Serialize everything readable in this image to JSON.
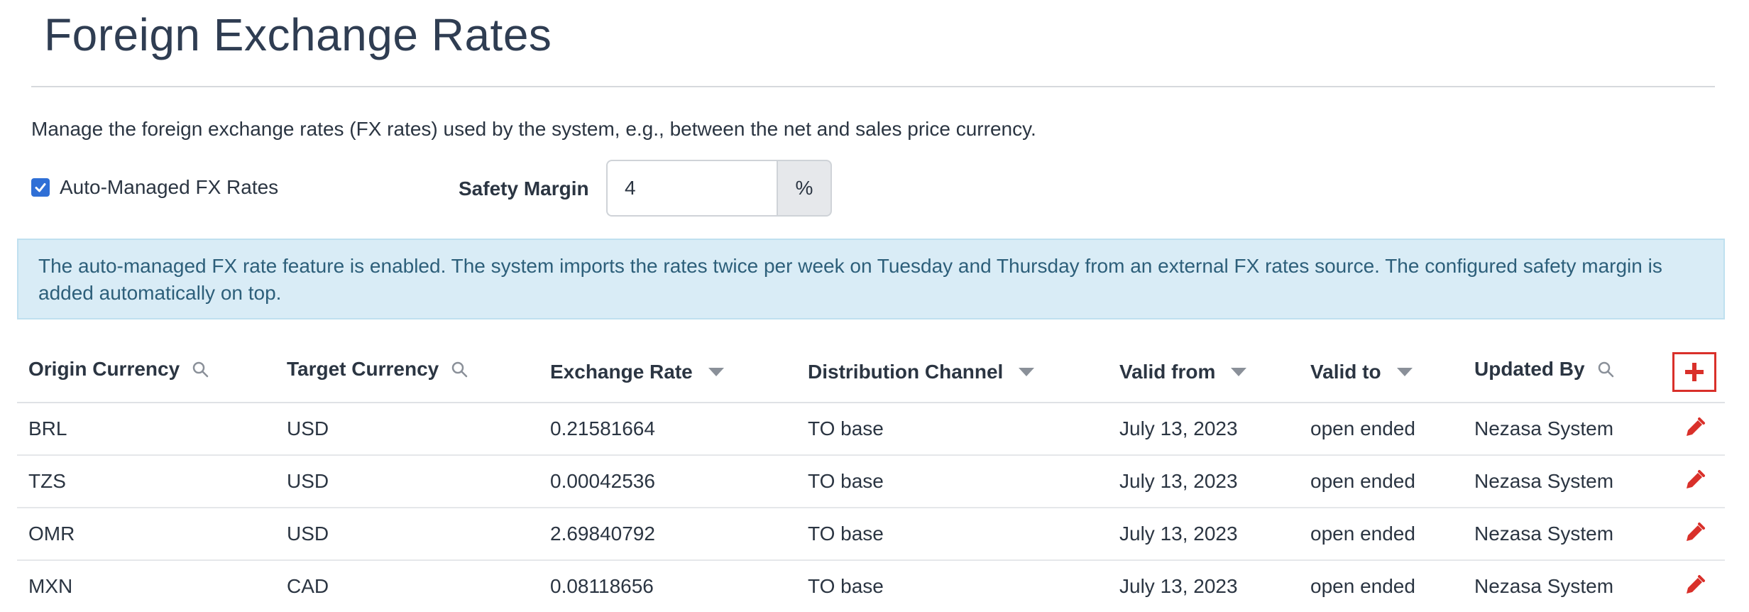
{
  "page": {
    "title": "Foreign Exchange Rates",
    "description": "Manage the foreign exchange rates (FX rates) used by the system, e.g., between the net and sales price currency."
  },
  "settings": {
    "auto_managed_label": "Auto-Managed FX Rates",
    "auto_managed_checked": true,
    "safety_margin_label": "Safety Margin",
    "safety_margin_value": "4",
    "safety_margin_unit": "%"
  },
  "info": {
    "message": "The auto-managed FX rate feature is enabled. The system imports the rates twice per week on Tuesday and Thursday from an external FX rates source. The configured safety margin is added automatically on top."
  },
  "table": {
    "headers": {
      "origin": "Origin Currency",
      "target": "Target Currency",
      "rate": "Exchange Rate",
      "channel": "Distribution Channel",
      "valid_from": "Valid from",
      "valid_to": "Valid to",
      "updated_by": "Updated By"
    },
    "rows": [
      {
        "origin": "BRL",
        "target": "USD",
        "rate": "0.21581664",
        "channel": "TO base",
        "valid_from": "July 13, 2023",
        "valid_to": "open ended",
        "updated_by": "Nezasa System"
      },
      {
        "origin": "TZS",
        "target": "USD",
        "rate": "0.00042536",
        "channel": "TO base",
        "valid_from": "July 13, 2023",
        "valid_to": "open ended",
        "updated_by": "Nezasa System"
      },
      {
        "origin": "OMR",
        "target": "USD",
        "rate": "2.69840792",
        "channel": "TO base",
        "valid_from": "July 13, 2023",
        "valid_to": "open ended",
        "updated_by": "Nezasa System"
      },
      {
        "origin": "MXN",
        "target": "CAD",
        "rate": "0.08118656",
        "channel": "TO base",
        "valid_from": "July 13, 2023",
        "valid_to": "open ended",
        "updated_by": "Nezasa System"
      }
    ]
  },
  "colors": {
    "accent_red": "#d9302a",
    "info_bg": "#d9ecf6",
    "checkbox_blue": "#2f6fd6"
  }
}
